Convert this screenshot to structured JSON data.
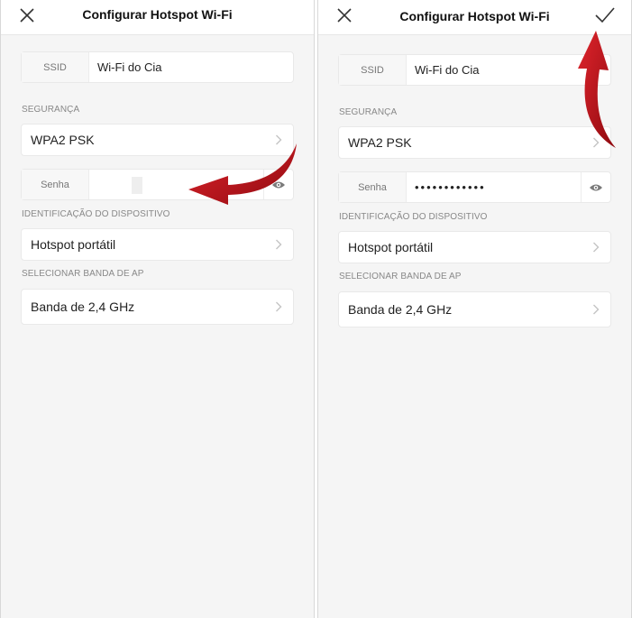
{
  "screens": [
    {
      "title": "Configurar Hotspot Wi-Fi",
      "ssid_label": "SSID",
      "ssid_value": "Wi-Fi do Cia",
      "security_section": "SEGURANÇA",
      "security_value": "WPA2 PSK",
      "password_label": "Senha",
      "password_value": "",
      "device_section": "IDENTIFICAÇÃO DO DISPOSITIVO",
      "device_value": "Hotspot portátil",
      "band_section": "SELECIONAR BANDA DE AP",
      "band_value": "Banda de 2,4 GHz"
    },
    {
      "title": "Configurar Hotspot Wi-Fi",
      "ssid_label": "SSID",
      "ssid_value": "Wi-Fi do Cia",
      "security_section": "SEGURANÇA",
      "security_value": "WPA2 PSK",
      "password_label": "Senha",
      "password_value": "••••••••••••",
      "device_section": "IDENTIFICAÇÃO DO DISPOSITIVO",
      "device_value": "Hotspot portátil",
      "band_section": "SELECIONAR BANDA DE AP",
      "band_value": "Banda de 2,4 GHz"
    }
  ],
  "icons": {
    "close": "close-icon",
    "confirm": "checkmark-icon",
    "chevron": "chevron-right-icon",
    "eye": "eye-icon",
    "annotation": "red-arrow-icon"
  },
  "colors": {
    "annotation_arrow": "#c8101a",
    "panel_background": "#f5f5f5",
    "card_background": "#ffffff"
  }
}
